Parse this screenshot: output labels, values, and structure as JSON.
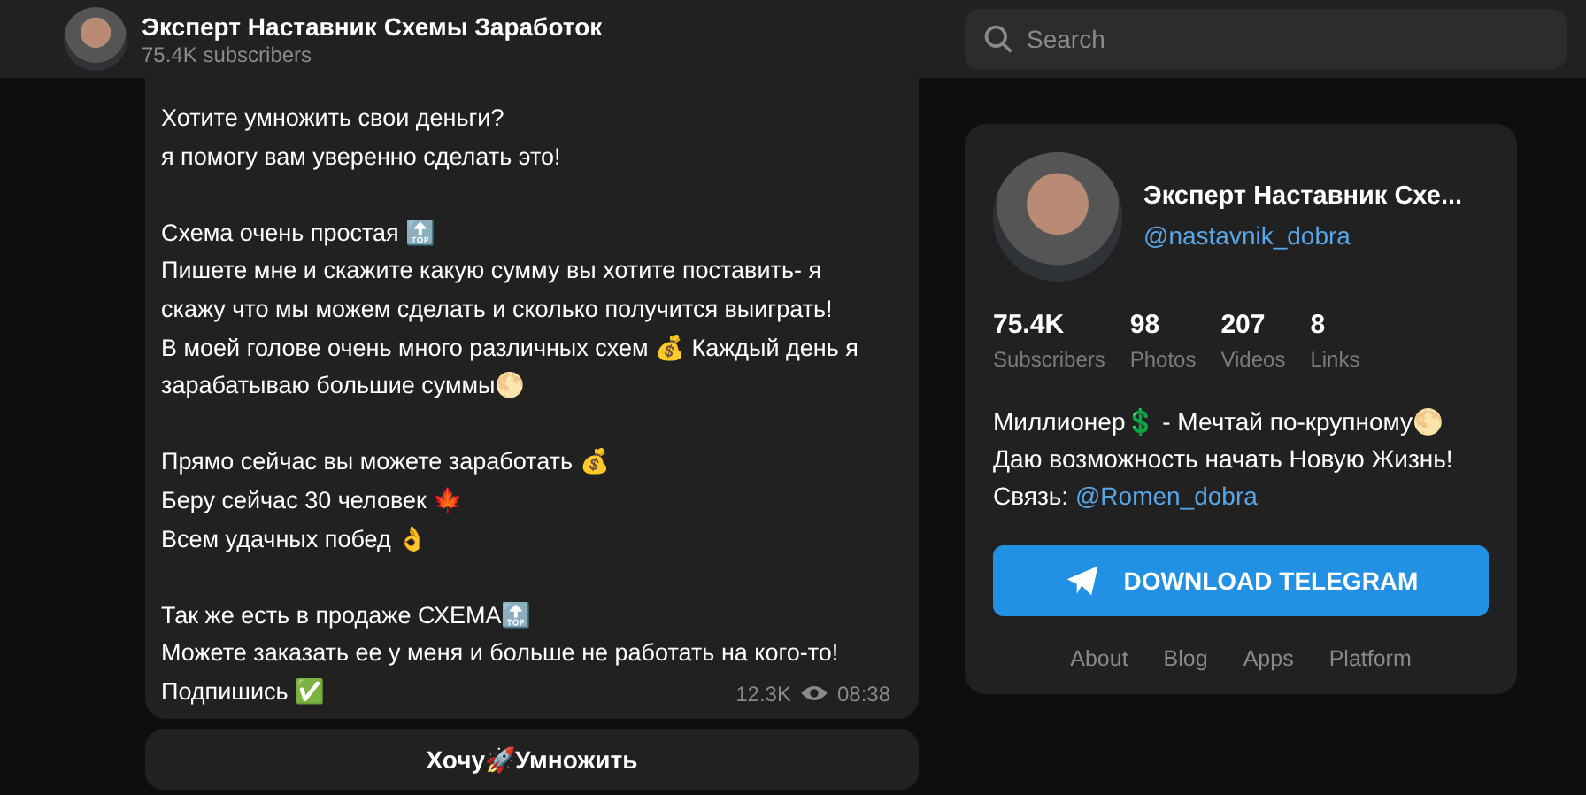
{
  "header": {
    "title": "Эксперт Наставник Схемы Заработок",
    "subtitle": "75.4K subscribers"
  },
  "search": {
    "placeholder": "Search"
  },
  "message": {
    "paragraphs": [
      [
        "Хотите умножить свои деньги?",
        "я помогу вам уверенно сделать это!"
      ],
      [
        "Схема очень простая 🔝",
        "Пишете мне и скажите какую сумму вы хотите поставить- я скажу что мы можем сделать и сколько получится выиграть!",
        "В моей голове очень много различных схем 💰 Каждый день я зарабатываю большие суммы🌕"
      ],
      [
        "Прямо сейчас вы можете заработать 💰",
        "Беру сейчас 30 человек 🍁",
        "Всем удачных побед 👌"
      ],
      [
        "Так же есть в продаже СХЕМА🔝",
        "Можете заказать ее у меня и больше не работать на кого-то!",
        "Подпишись ✅"
      ]
    ],
    "views": "12.3K",
    "time": "08:38"
  },
  "inline_button": {
    "label": "Хочу🚀Умножить"
  },
  "channel_card": {
    "name": "Эксперт Наставник Схе...",
    "username": "@nastavnik_dobra",
    "stats": [
      {
        "value": "75.4K",
        "label": "Subscribers"
      },
      {
        "value": "98",
        "label": "Photos"
      },
      {
        "value": "207",
        "label": "Videos"
      },
      {
        "value": "8",
        "label": "Links"
      }
    ],
    "description": [
      {
        "kind": "text",
        "text": "Миллионер💲 - Мечтай по-крупному🌕"
      },
      {
        "kind": "text",
        "text": "Даю возможность начать Новую Жизнь!"
      },
      {
        "kind": "contact",
        "text": "Связь: ",
        "link": "@Romen_dobra"
      }
    ],
    "download_button": {
      "label": "DOWNLOAD TELEGRAM"
    },
    "footer_links": [
      "About",
      "Blog",
      "Apps",
      "Platform"
    ]
  }
}
